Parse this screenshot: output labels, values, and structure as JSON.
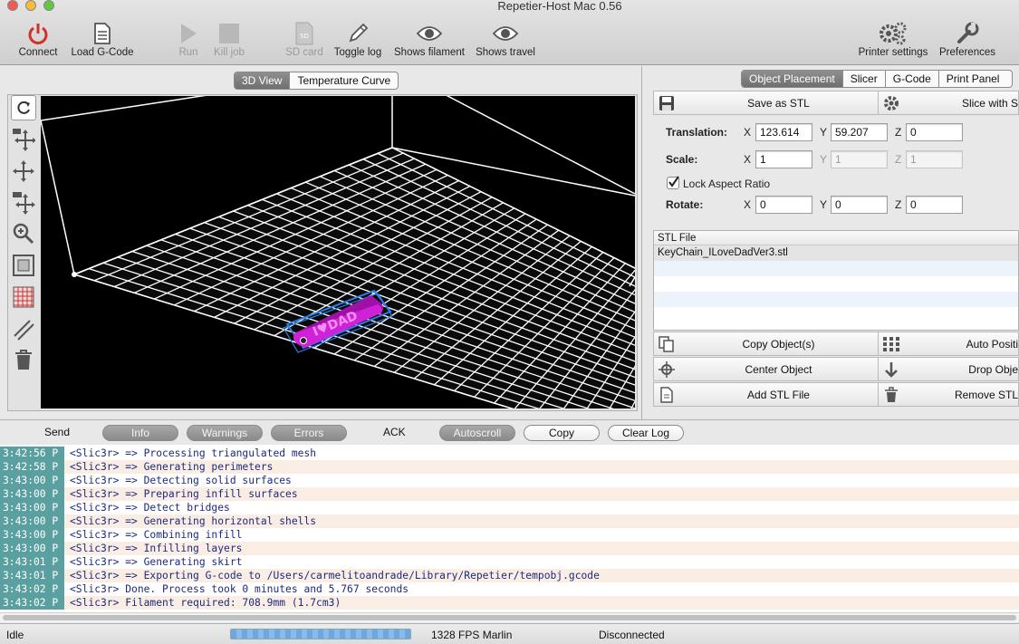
{
  "window": {
    "title": "Repetier-Host Mac 0.56"
  },
  "toolbar": {
    "connect": "Connect",
    "load_gcode": "Load G-Code",
    "run": "Run",
    "kill_job": "Kill job",
    "sd_card": "SD card",
    "toggle_log": "Toggle log",
    "shows_filament": "Shows filament",
    "shows_travel": "Shows travel",
    "printer_settings": "Printer settings",
    "preferences": "Preferences"
  },
  "view_tabs": [
    "3D View",
    "Temperature Curve"
  ],
  "right_tabs": [
    "Object Placement",
    "Slicer",
    "G-Code",
    "Print Panel"
  ],
  "placement": {
    "save_stl": "Save as STL",
    "slice_with": "Slice with S",
    "translation_label": "Translation:",
    "scale_label": "Scale:",
    "rotate_label": "Rotate:",
    "lock_aspect": "Lock Aspect Ratio",
    "axes": [
      "X",
      "Y",
      "Z"
    ],
    "translation": {
      "x": "123.614",
      "y": "59.207",
      "z": "0"
    },
    "scale": {
      "x": "1",
      "y": "1",
      "z": "1"
    },
    "rotate": {
      "x": "0",
      "y": "0",
      "z": "0"
    }
  },
  "stl_list": {
    "header": "STL File",
    "files": [
      "KeyChain_ILoveDadVer3.stl"
    ]
  },
  "object_buttons": {
    "copy_objects": "Copy Object(s)",
    "auto_position": "Auto Positi",
    "center_object": "Center Object",
    "drop_object": "Drop Obje",
    "add_stl": "Add STL File",
    "remove_stl": "Remove STL"
  },
  "log_toolbar": {
    "send": "Send",
    "info": "Info",
    "warnings": "Warnings",
    "errors": "Errors",
    "ack": "ACK",
    "autoscroll": "Autoscroll",
    "copy": "Copy",
    "clear_log": "Clear Log"
  },
  "log": [
    {
      "time": "3:42:56 P",
      "msg": "<Slic3r> => Processing triangulated mesh"
    },
    {
      "time": "3:42:58 P",
      "msg": "<Slic3r> => Generating perimeters"
    },
    {
      "time": "3:43:00 P",
      "msg": "<Slic3r> => Detecting solid surfaces"
    },
    {
      "time": "3:43:00 P",
      "msg": "<Slic3r> => Preparing infill surfaces"
    },
    {
      "time": "3:43:00 P",
      "msg": "<Slic3r> => Detect bridges"
    },
    {
      "time": "3:43:00 P",
      "msg": "<Slic3r> => Generating horizontal shells"
    },
    {
      "time": "3:43:00 P",
      "msg": "<Slic3r> => Combining infill"
    },
    {
      "time": "3:43:00 P",
      "msg": "<Slic3r> => Infilling layers"
    },
    {
      "time": "3:43:01 P",
      "msg": "<Slic3r> => Generating skirt"
    },
    {
      "time": "3:43:01 P",
      "msg": "<Slic3r> => Exporting G-code to /Users/carmelitoandrade/Library/Repetier/tempobj.gcode"
    },
    {
      "time": "3:43:02 P",
      "msg": "<Slic3r> Done. Process took 0 minutes and 5.767 seconds"
    },
    {
      "time": "3:43:02 P",
      "msg": "<Slic3r> Filament required: 708.9mm (1.7cm3)"
    }
  ],
  "status": {
    "state": "Idle",
    "fps": "1328 FPS Marlin",
    "connection": "Disconnected"
  },
  "colors": {
    "accent": "#6f6f6f",
    "log_time_bg": "#5aa0a0",
    "log_text": "#1c2a80",
    "object": "#d020d8"
  }
}
